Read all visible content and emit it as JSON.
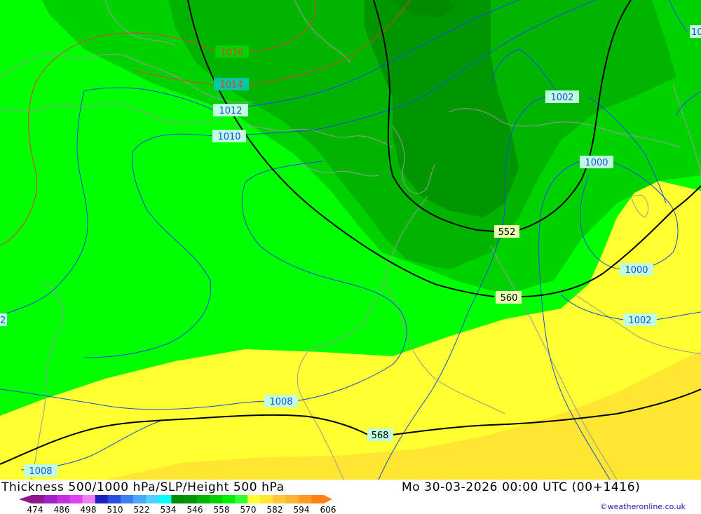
{
  "title": "Thickness 500/1000 hPa/SLP/Height 500 hPa",
  "datetime": "Mo 30-03-2026 00:00 UTC (00+1416)",
  "credit": "©weatheronline.co.uk",
  "legend": {
    "ticks": [
      "474",
      "486",
      "498",
      "510",
      "522",
      "534",
      "546",
      "558",
      "570",
      "582",
      "594",
      "606"
    ],
    "colors": [
      "#8c1a8c",
      "#a020c8",
      "#c030e0",
      "#e040f0",
      "#f080f0",
      "#2020c0",
      "#2a4ce0",
      "#3c7ef0",
      "#48a8f8",
      "#50d0fa",
      "#00ffff",
      "#008c00",
      "#009600",
      "#00b400",
      "#00d200",
      "#00f000",
      "#32ff32",
      "#ffff32",
      "#ffe632",
      "#ffc832",
      "#ffb432",
      "#ff9c1e",
      "#ff8214"
    ]
  },
  "labels": {
    "p1016": "1016",
    "p1014": "1014",
    "p1012": "1012",
    "p1010": "1010",
    "p1002a": "1002",
    "p1000a": "1000",
    "p1000b": "1000",
    "p1002b": "1002",
    "p1008a": "1008",
    "p1008b": "1008",
    "p101x": "10",
    "p10xx": "2",
    "h552": "552",
    "h560": "560",
    "h568": "568"
  },
  "colors": {
    "green_bright": "#00ff00",
    "green_mid": "#00d200",
    "green_dark": "#00b400",
    "green_darker": "#009600",
    "yellow": "#ffff32",
    "yellow_dark": "#ffe632",
    "isobar_blue": "#1a4ce0",
    "isobar_red": "#e03c3c",
    "height_black": "#000000",
    "coast": "#9a9a9a"
  }
}
